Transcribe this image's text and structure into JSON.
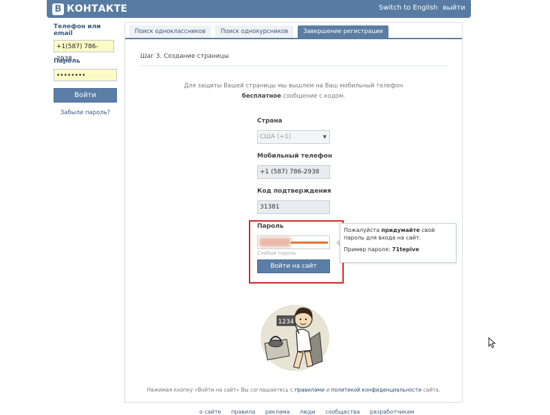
{
  "header": {
    "logo_letter": "В",
    "logo_text": "КОНТАКТЕ",
    "switch_language": "Switch to English",
    "logout": "выйти",
    "color": "#587ba3"
  },
  "login": {
    "phone_label": "Телефон или email",
    "phone_value": "+1(587) 786-2938",
    "password_label": "Пароль",
    "password_value": "••••••••",
    "login_button": "Войти",
    "forgot_password": "Забыли пароль?"
  },
  "tabs": [
    {
      "label": "Поиск одноклассников",
      "active": false
    },
    {
      "label": "Поиск однокурсников",
      "active": false
    },
    {
      "label": "Завершение регистрации",
      "active": true
    }
  ],
  "step_title": "Шаг 3. Создание страницы",
  "info": {
    "line1": "Для защиты Вашей страницы мы вышлем на Ваш мобильный телефон",
    "bold": "бесплатное",
    "line2_rest": " сообщение с кодом."
  },
  "form": {
    "country_label": "Страна",
    "country_value": "США (+1)",
    "phone_label": "Мобильный телефон",
    "phone_value": "+1 (587) 786-2938",
    "code_label": "Код подтверждения",
    "code_value": "31381",
    "password_label": "Пароль",
    "password_strength": "Слабый пароль",
    "submit_button": "Войти на сайт"
  },
  "tooltip": {
    "text_before": "Пожалуйста ",
    "text_bold": "придумайте",
    "text_after": " свой пароль для входа на сайт.",
    "example_label": "Пример пароля: ",
    "example_value": "71tepive"
  },
  "illustration": {
    "sign_text": "1234"
  },
  "footer_note": {
    "before": "Нажимая кнопку «Войти на сайт» Вы соглашаетесь с ",
    "rules": "правилами",
    "and": " и ",
    "privacy": "политикой конфиденциальности",
    "after": " сайта."
  },
  "bottom_links": [
    "о сайте",
    "правила",
    "реклама",
    "люди",
    "сообщества",
    "разработчикам"
  ]
}
